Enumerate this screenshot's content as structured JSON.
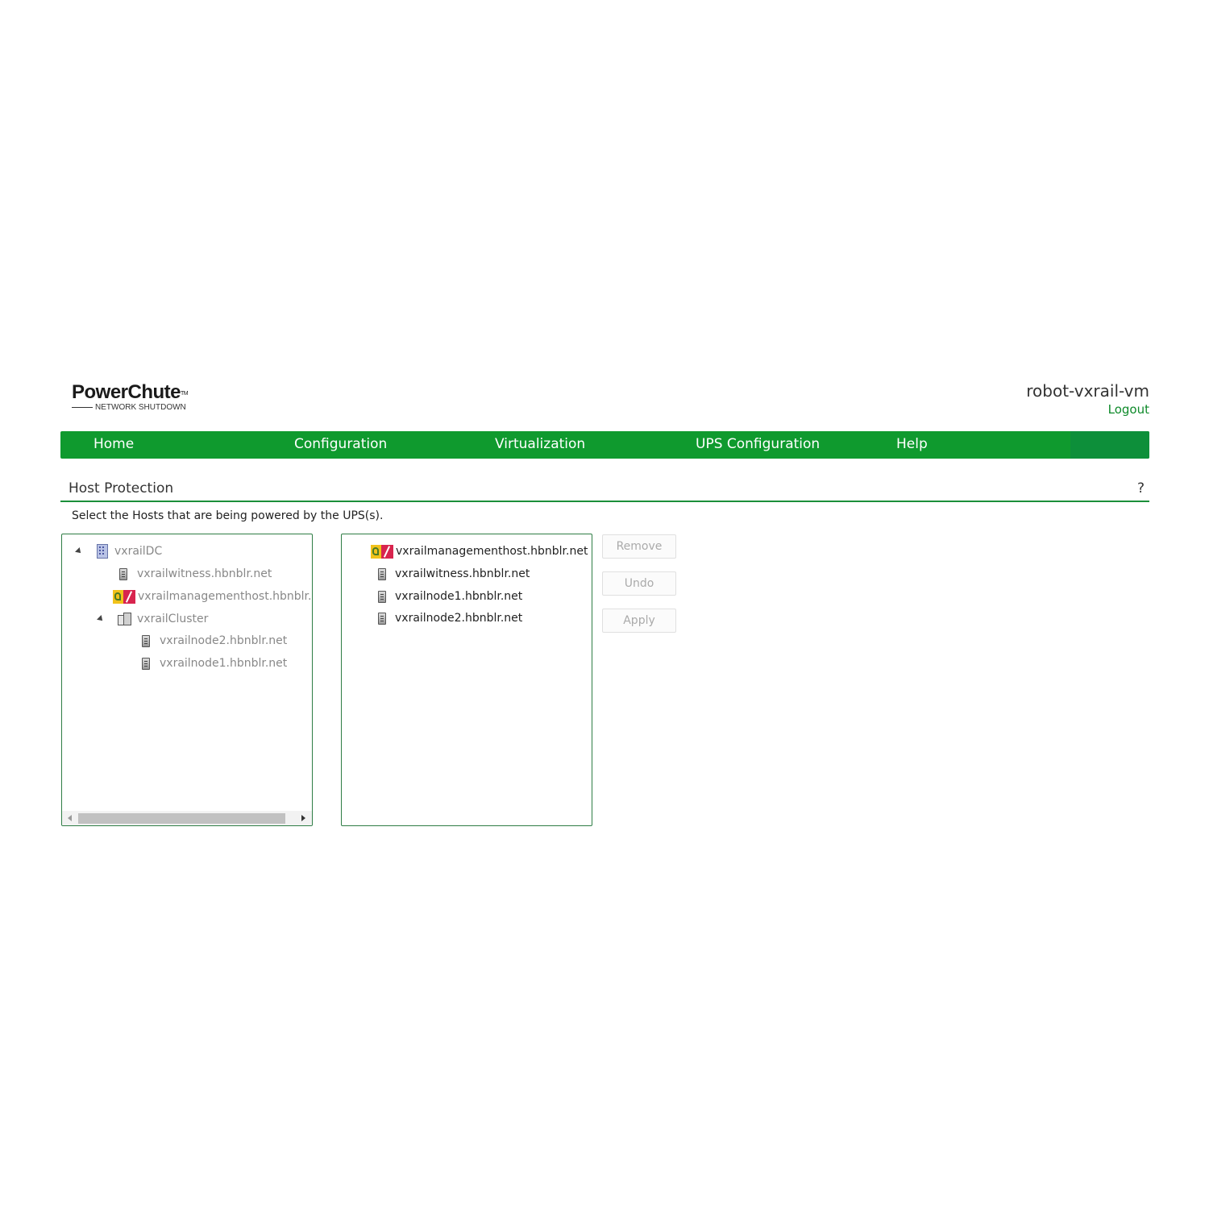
{
  "header": {
    "logo_title": "PowerChute",
    "logo_tm": "TM",
    "logo_subtitle": "NETWORK SHUTDOWN",
    "hostname": "robot-vxrail-vm",
    "logout_label": "Logout"
  },
  "nav": {
    "items": [
      {
        "label": "Home"
      },
      {
        "label": "Configuration"
      },
      {
        "label": "Virtualization"
      },
      {
        "label": "UPS Configuration"
      },
      {
        "label": "Help"
      }
    ]
  },
  "page": {
    "title": "Host Protection",
    "help": "?",
    "instruction": "Select the Hosts that are being powered by the UPS(s)."
  },
  "left_tree": {
    "items": [
      {
        "label": "vxrailDC",
        "icon": "datacenter-icon",
        "expanded": true
      },
      {
        "label": "vxrailwitness.hbnblr.net",
        "icon": "server-icon"
      },
      {
        "label": "vxrailmanagementhost.hbnblr.net",
        "icon": "vm-host-icon"
      },
      {
        "label": "vxrailCluster",
        "icon": "cluster-icon",
        "expanded": true
      },
      {
        "label": "vxrailnode2.hbnblr.net",
        "icon": "server-icon"
      },
      {
        "label": "vxrailnode1.hbnblr.net",
        "icon": "server-icon"
      }
    ]
  },
  "right_list": {
    "items": [
      {
        "label": "vxrailmanagementhost.hbnblr.net",
        "icon": "vm-host-icon"
      },
      {
        "label": "vxrailwitness.hbnblr.net",
        "icon": "server-icon"
      },
      {
        "label": "vxrailnode1.hbnblr.net",
        "icon": "server-icon"
      },
      {
        "label": "vxrailnode2.hbnblr.net",
        "icon": "server-icon"
      }
    ]
  },
  "buttons": {
    "remove": "Remove",
    "undo": "Undo",
    "apply": "Apply",
    "disabled": true
  },
  "colors": {
    "brand_green": "#0f9a2e",
    "link_green": "#0e8a2a",
    "rule_green": "#1b8f3a"
  }
}
